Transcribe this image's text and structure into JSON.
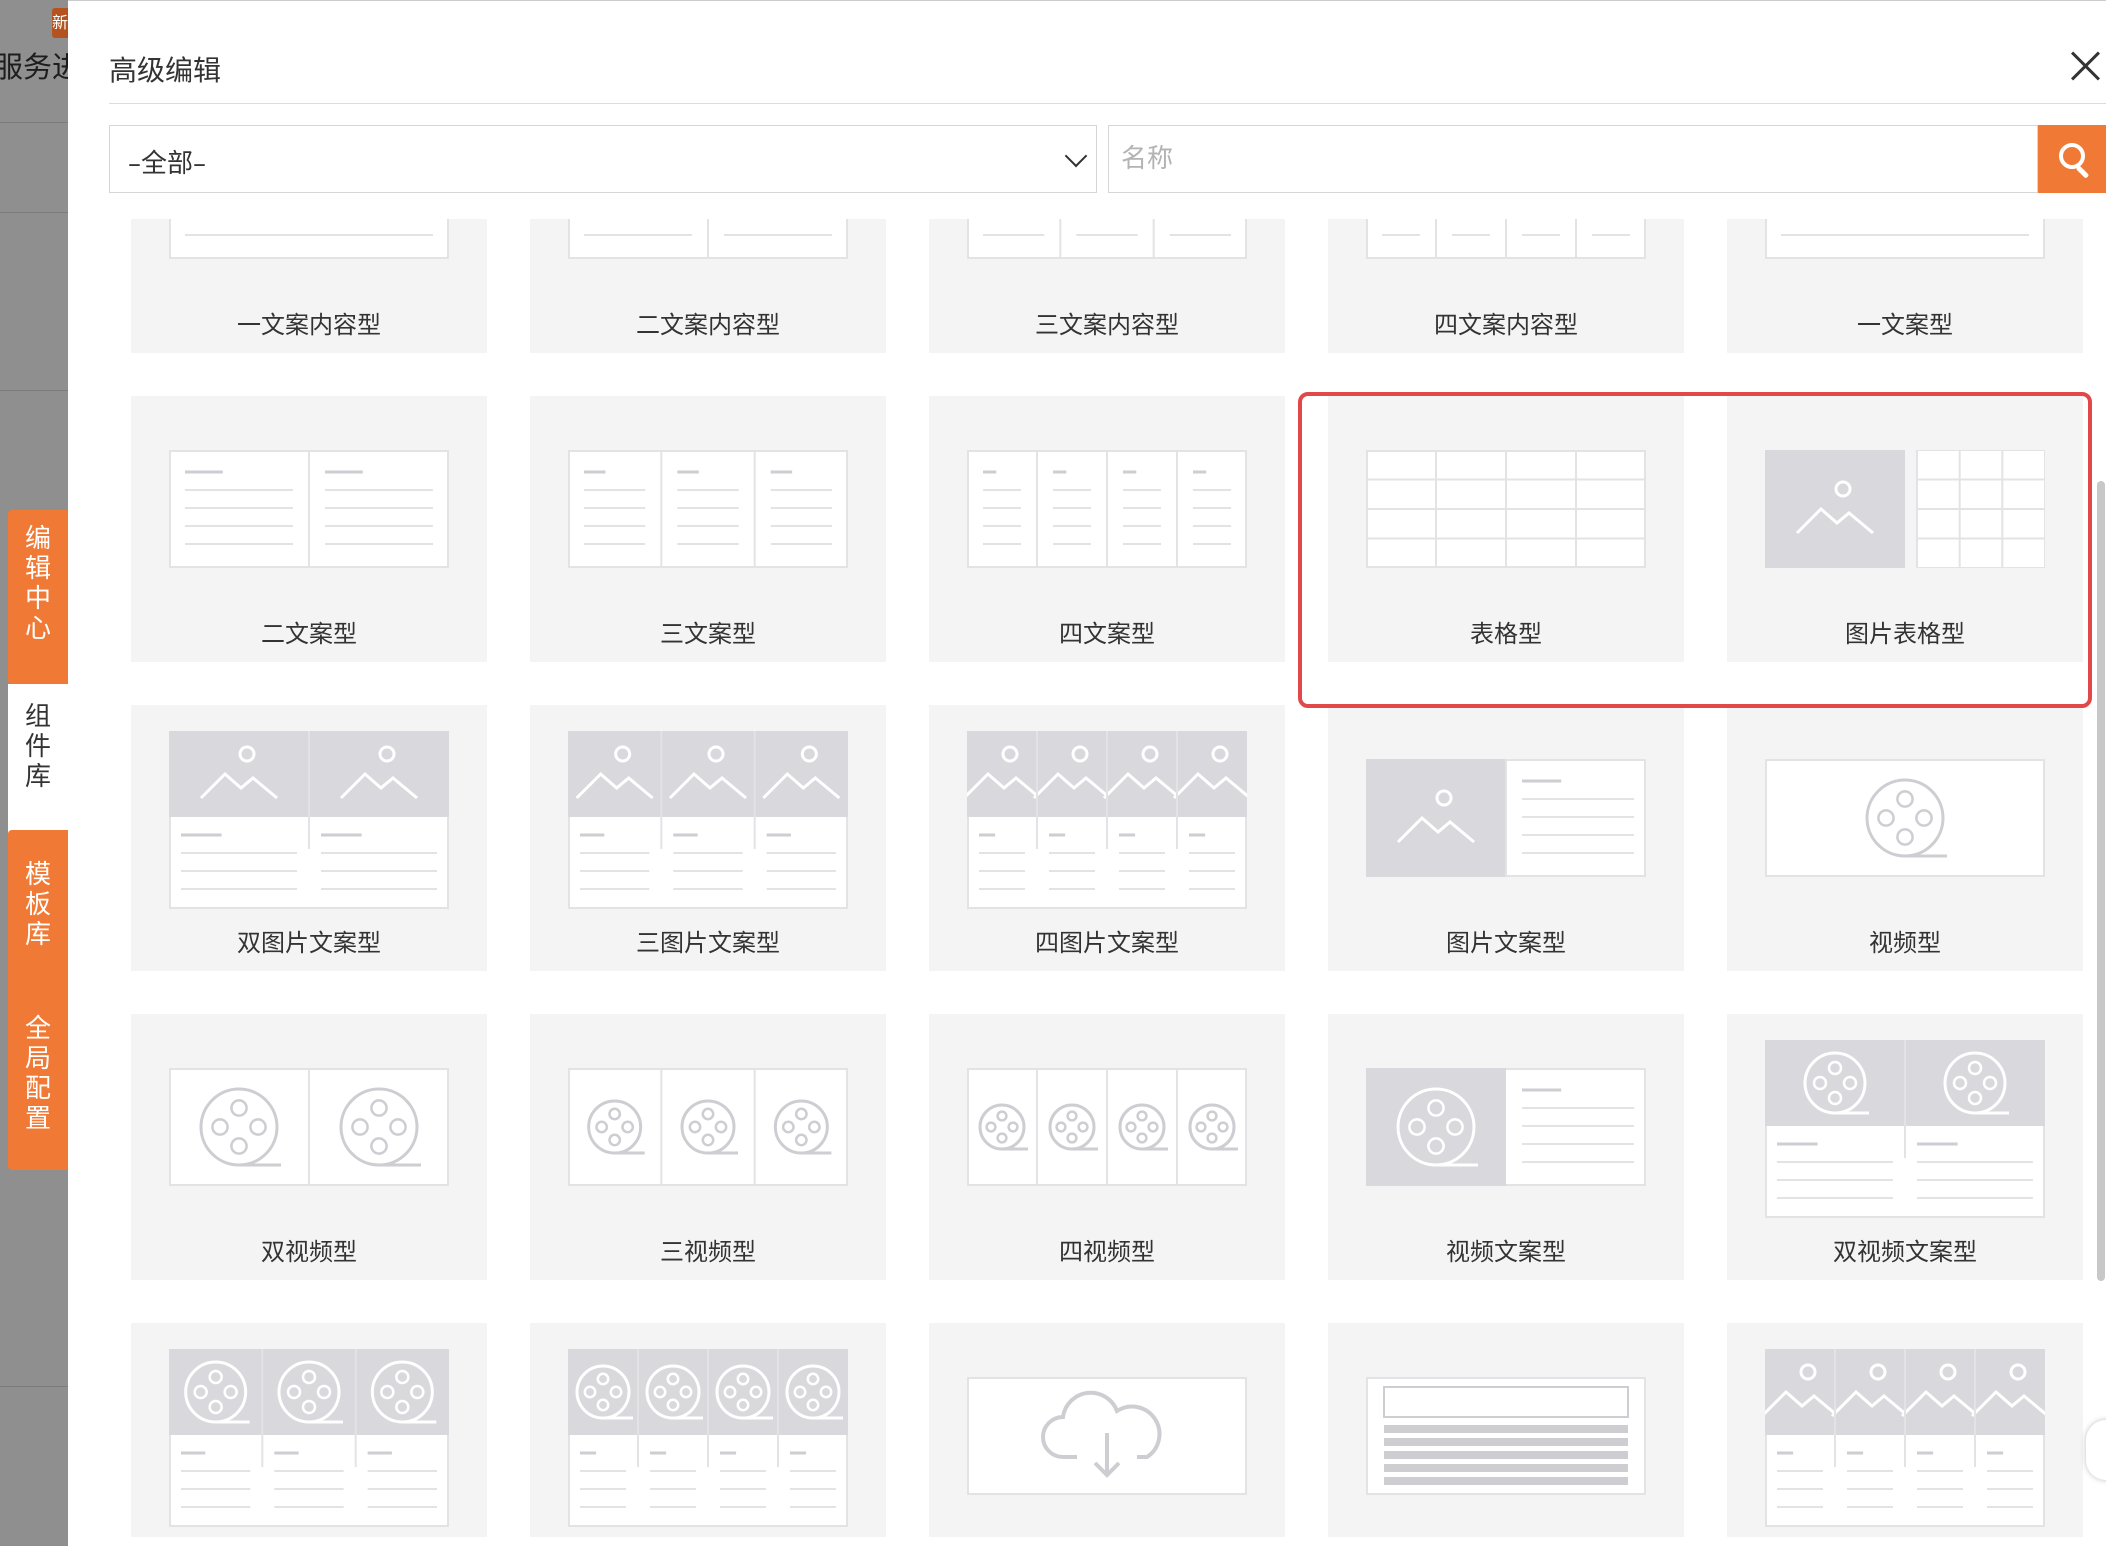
{
  "backdrop": {
    "title": "服务进度",
    "badge": "新"
  },
  "side_tabs": [
    "编辑中心",
    "组件库",
    "模板库",
    "全局配置"
  ],
  "dialog": {
    "title": "高级编辑",
    "filter": {
      "selected": "–全部–"
    },
    "search": {
      "placeholder": "名称"
    }
  },
  "components": [
    {
      "label": "一文案内容型",
      "icon": "text-1"
    },
    {
      "label": "二文案内容型",
      "icon": "text-2"
    },
    {
      "label": "三文案内容型",
      "icon": "text-3"
    },
    {
      "label": "四文案内容型",
      "icon": "text-4"
    },
    {
      "label": "一文案型",
      "icon": "text-1"
    },
    {
      "label": "二文案型",
      "icon": "text-2"
    },
    {
      "label": "三文案型",
      "icon": "text-3"
    },
    {
      "label": "四文案型",
      "icon": "text-4"
    },
    {
      "label": "表格型",
      "icon": "table"
    },
    {
      "label": "图片表格型",
      "icon": "image-table"
    },
    {
      "label": "双图片文案型",
      "icon": "image-text-2"
    },
    {
      "label": "三图片文案型",
      "icon": "image-text-3"
    },
    {
      "label": "四图片文案型",
      "icon": "image-text-4"
    },
    {
      "label": "图片文案型",
      "icon": "image-text-side"
    },
    {
      "label": "视频型",
      "icon": "video-1"
    },
    {
      "label": "双视频型",
      "icon": "video-2"
    },
    {
      "label": "三视频型",
      "icon": "video-3"
    },
    {
      "label": "四视频型",
      "icon": "video-4"
    },
    {
      "label": "视频文案型",
      "icon": "video-text-side"
    },
    {
      "label": "双视频文案型",
      "icon": "video-text-2"
    },
    {
      "label": "",
      "icon": "video-text-3"
    },
    {
      "label": "",
      "icon": "video-text-4"
    },
    {
      "label": "",
      "icon": "upload"
    },
    {
      "label": "",
      "icon": "form"
    },
    {
      "label": "",
      "icon": "image-text-4"
    }
  ],
  "highlighted": [
    "表格型",
    "图片表格型"
  ]
}
